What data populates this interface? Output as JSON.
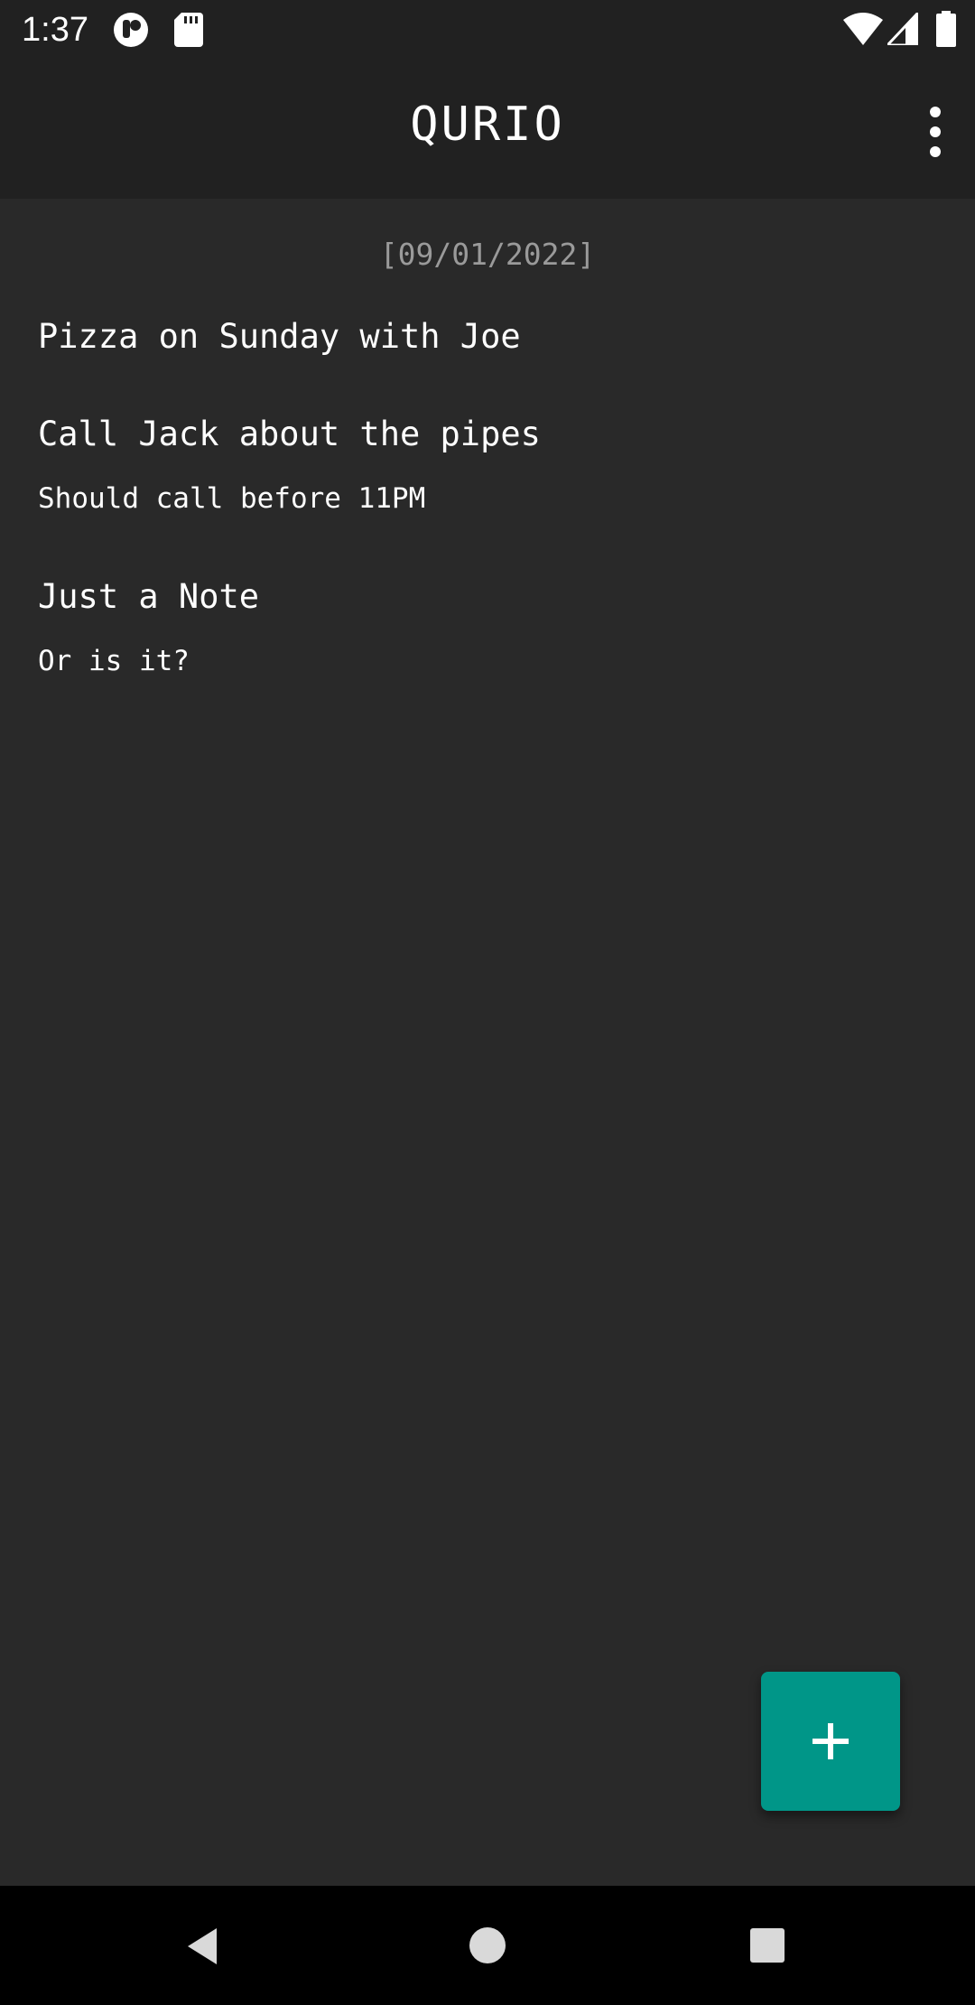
{
  "status_bar": {
    "time": "1:37",
    "icons": [
      "app-notification-icon",
      "sd-card-icon",
      "wifi-icon",
      "cell-signal-icon",
      "battery-icon"
    ]
  },
  "app_bar": {
    "title": "QURIO",
    "overflow_icon": "more-vert-icon"
  },
  "notes_list": {
    "date_header": "[09/01/2022]",
    "notes": [
      {
        "title": "Pizza on Sunday with Joe",
        "body": ""
      },
      {
        "title": "Call Jack about the pipes",
        "body": "Should call before 11PM"
      },
      {
        "title": "Just a Note",
        "body": "Or is it?"
      }
    ]
  },
  "fab": {
    "icon": "plus-icon",
    "color": "#009688"
  },
  "nav_bar": {
    "buttons": [
      "back-icon",
      "home-icon",
      "recents-icon"
    ]
  },
  "colors": {
    "app_bar": "#212121",
    "background": "#292929",
    "accent": "#009688"
  }
}
